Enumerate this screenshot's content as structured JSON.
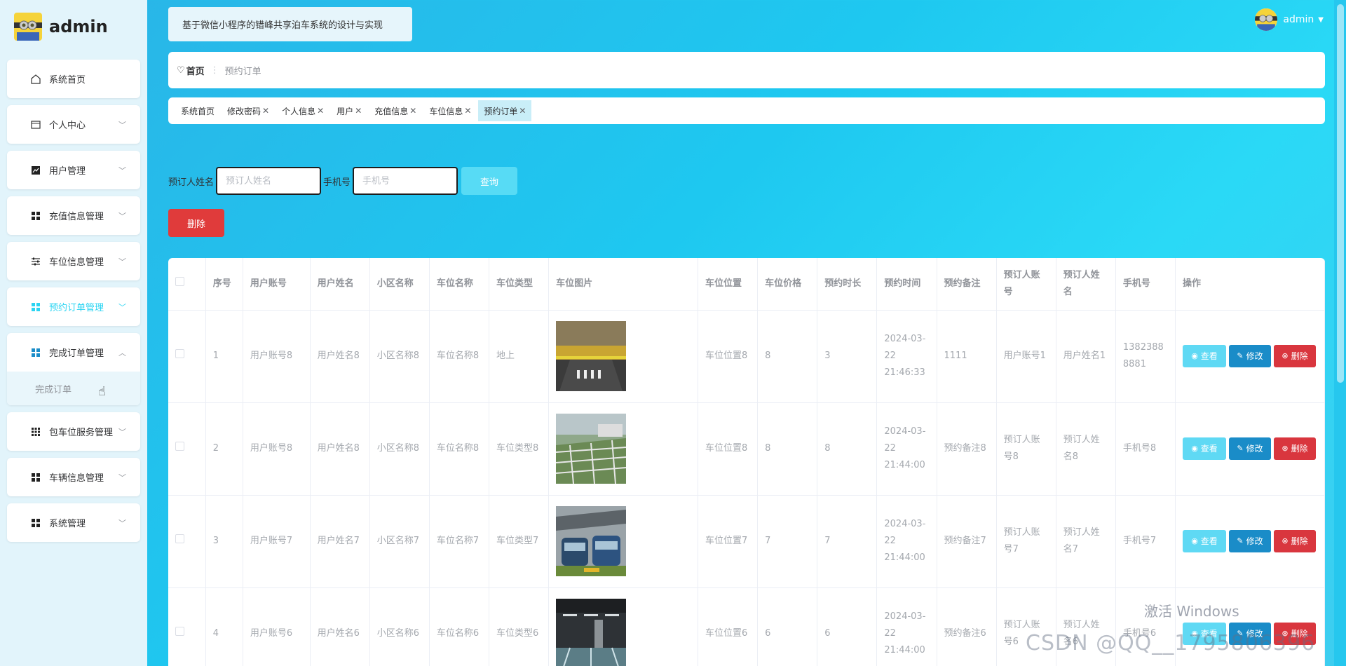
{
  "app": {
    "brand": "admin",
    "system_title": "基于微信小程序的错峰共享泊车系统的设计与实现",
    "user": "admin"
  },
  "sidebar": {
    "items": [
      {
        "label": "系统首页",
        "icon": "home-icon"
      },
      {
        "label": "个人中心",
        "icon": "card-icon"
      },
      {
        "label": "用户管理",
        "icon": "chart-icon"
      },
      {
        "label": "充值信息管理",
        "icon": "grid-icon"
      },
      {
        "label": "车位信息管理",
        "icon": "sliders-icon"
      },
      {
        "label": "预约订单管理",
        "icon": "grid-icon"
      },
      {
        "label": "完成订单管理",
        "icon": "grid-icon"
      },
      {
        "label": "包车位服务管理",
        "icon": "grid9-icon"
      },
      {
        "label": "车辆信息管理",
        "icon": "grid-icon"
      },
      {
        "label": "系统管理",
        "icon": "grid-icon"
      }
    ],
    "sub_item": "完成订单"
  },
  "breadcrumb": {
    "home": "首页",
    "current": "预约订单"
  },
  "tags": [
    {
      "label": "系统首页",
      "closable": false
    },
    {
      "label": "修改密码",
      "closable": true
    },
    {
      "label": "个人信息",
      "closable": true
    },
    {
      "label": "用户",
      "closable": true
    },
    {
      "label": "充值信息",
      "closable": true
    },
    {
      "label": "车位信息",
      "closable": true
    },
    {
      "label": "预约订单",
      "closable": true
    }
  ],
  "search": {
    "name_label": "预订人姓名",
    "name_placeholder": "预订人姓名",
    "phone_label": "手机号",
    "phone_placeholder": "手机号",
    "query_button": "查询",
    "delete_button": "删除"
  },
  "table": {
    "headers": [
      "序号",
      "用户账号",
      "用户姓名",
      "小区名称",
      "车位名称",
      "车位类型",
      "车位图片",
      "车位位置",
      "车位价格",
      "预约时长",
      "预约时间",
      "预约备注",
      "预订人账号",
      "预订人姓名",
      "手机号",
      "操作"
    ],
    "actions": {
      "view": "查看",
      "edit": "修改",
      "delete": "删除"
    },
    "rows": [
      {
        "no": "1",
        "account": "用户账号8",
        "name": "用户姓名8",
        "community": "小区名称8",
        "space": "车位名称8",
        "type": "地上",
        "img": "yellow",
        "location": "车位位置8",
        "price": "8",
        "duration": "3",
        "time": "2024-03-22 21:46:33",
        "remark": "1111",
        "booker_account": "用户账号1",
        "booker_name": "用户姓名1",
        "phone": "13823888881"
      },
      {
        "no": "2",
        "account": "用户账号8",
        "name": "用户姓名8",
        "community": "小区名称8",
        "space": "车位名称8",
        "type": "车位类型8",
        "img": "grass",
        "location": "车位位置8",
        "price": "8",
        "duration": "8",
        "time": "2024-03-22 21:44:00",
        "remark": "预约备注8",
        "booker_account": "预订人账号8",
        "booker_name": "预订人姓名8",
        "phone": "手机号8"
      },
      {
        "no": "3",
        "account": "用户账号7",
        "name": "用户姓名7",
        "community": "小区名称7",
        "space": "车位名称7",
        "type": "车位类型7",
        "img": "bus",
        "location": "车位位置7",
        "price": "7",
        "duration": "7",
        "time": "2024-03-22 21:44:00",
        "remark": "预约备注7",
        "booker_account": "预订人账号7",
        "booker_name": "预订人姓名7",
        "phone": "手机号7"
      },
      {
        "no": "4",
        "account": "用户账号6",
        "name": "用户姓名6",
        "community": "小区名称6",
        "space": "车位名称6",
        "type": "车位类型6",
        "img": "garage",
        "location": "车位位置6",
        "price": "6",
        "duration": "6",
        "time": "2024-03-22 21:44:00",
        "remark": "预约备注6",
        "booker_account": "预订人账号6",
        "booker_name": "预订人姓名6",
        "phone": "手机号6"
      }
    ]
  },
  "overlay": {
    "activate_windows": "激活 Windows",
    "watermark": "CSDN @QQ__1795806396"
  },
  "colors": {
    "accent": "#2ad4f2",
    "danger": "#d9363e",
    "edit": "#1a8cc8",
    "view": "#5fd9f4"
  }
}
